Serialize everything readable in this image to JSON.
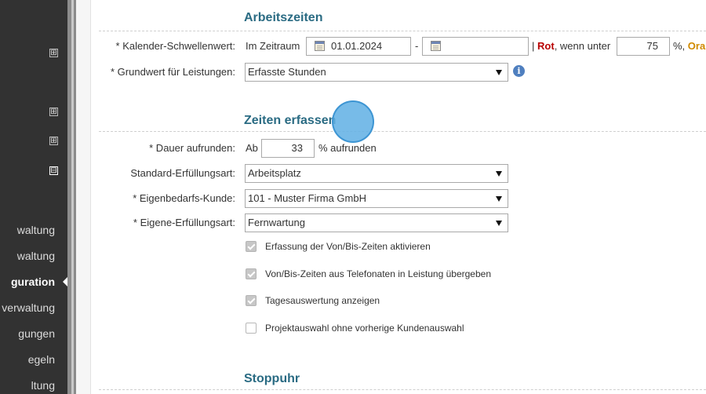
{
  "sidebar": {
    "items": [
      {
        "label": "waltung"
      },
      {
        "label": "waltung"
      },
      {
        "label": "guration",
        "active": true
      },
      {
        "label": "verwaltung"
      },
      {
        "label": "gungen"
      },
      {
        "label": "egeln"
      },
      {
        "label": "ltung"
      }
    ],
    "expanders": [
      {
        "symbol": "⊞"
      },
      {
        "symbol": "⊞"
      },
      {
        "symbol": "⊞"
      },
      {
        "symbol": "⊟"
      }
    ]
  },
  "arbeitszeiten": {
    "title": "Arbeitszeiten",
    "schwellenwert": {
      "label": "* Kalender-Schwellenwert:",
      "prefix": "Im Zeitraum",
      "date_from": "01.01.2024",
      "separator": "-",
      "date_to": "",
      "pipe": "|",
      "red_label": "Rot",
      "red_text": ", wenn unter",
      "threshold_value": "75",
      "percent_text": "%,",
      "orange_label": "Ora"
    },
    "grundwert": {
      "label": "* Grundwert für Leistungen:",
      "selected": "Erfasste Stunden"
    }
  },
  "zeiten_erfassen": {
    "title": "Zeiten erfassen",
    "dauer": {
      "label": "* Dauer aufrunden:",
      "prefix": "Ab",
      "value": "33",
      "suffix": "% aufrunden"
    },
    "standard_erfuellungsart": {
      "label": "Standard-Erfüllungsart:",
      "selected": "Arbeitsplatz"
    },
    "eigenbedarfs_kunde": {
      "label": "* Eigenbedarfs-Kunde:",
      "selected": "101 - Muster Firma GmbH"
    },
    "eigene_erfuellungsart": {
      "label": "* Eigene-Erfüllungsart:",
      "selected": "Fernwartung"
    },
    "checkboxes": [
      {
        "label": "Erfassung der Von/Bis-Zeiten aktivieren",
        "checked": true
      },
      {
        "label": "Von/Bis-Zeiten aus Telefonaten in Leistung übergeben",
        "checked": true
      },
      {
        "label": "Tagesauswertung anzeigen",
        "checked": true
      },
      {
        "label": "Projektauswahl ohne vorherige Kundenauswahl",
        "checked": false
      }
    ]
  },
  "stoppuhr": {
    "title": "Stoppuhr"
  },
  "icons": {
    "calendar": "calendar-icon",
    "info": "info-icon",
    "info_glyph": "i"
  },
  "colors": {
    "section_title": "#2a6b83",
    "red": "#b80000",
    "orange": "#d08a00",
    "sidebar_bg": "#323232"
  }
}
